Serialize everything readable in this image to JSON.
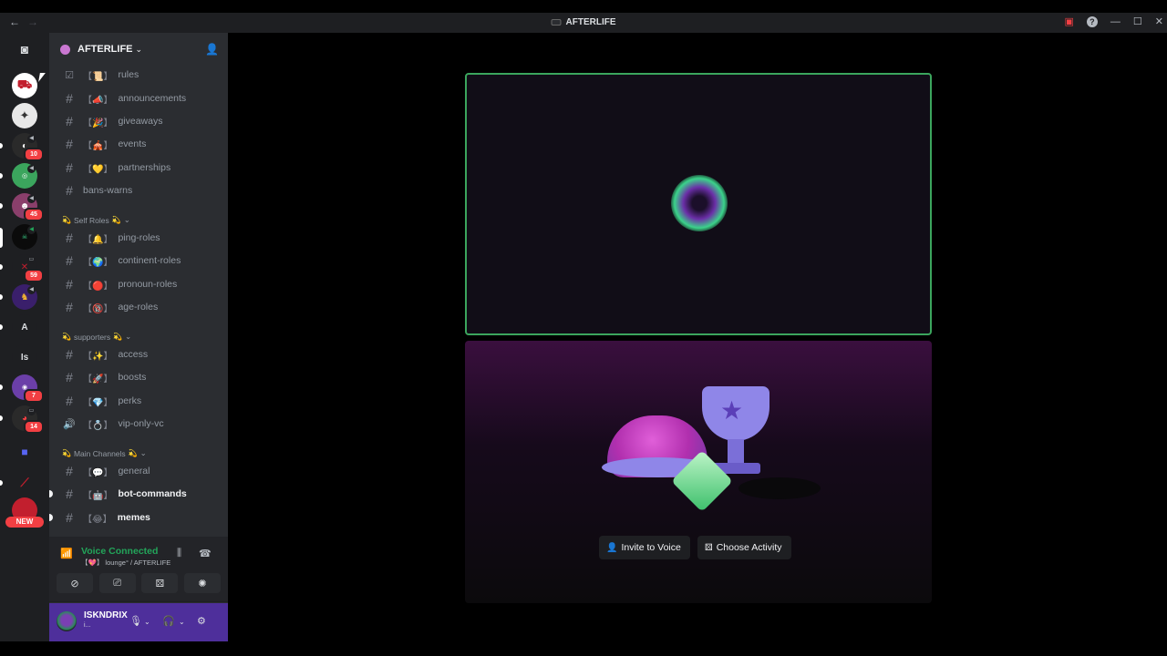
{
  "window": {
    "title": "AFTERLIFE",
    "back_icon": "←",
    "forward_icon": "→"
  },
  "server": {
    "name": "AFTERLIFE"
  },
  "rail": {
    "badges": [
      "10",
      "45",
      "59",
      "7",
      "14"
    ],
    "letter_servers": [
      "A",
      "Is"
    ],
    "new_label": "NEW"
  },
  "channels": {
    "info": [
      {
        "emoji": "【📜】",
        "name": "rules"
      },
      {
        "emoji": "【📣】",
        "name": "announcements"
      },
      {
        "emoji": "【🎉】",
        "name": "giveaways"
      },
      {
        "emoji": "【🎪】",
        "name": "events"
      },
      {
        "emoji": "【💛】",
        "name": "partnerships"
      },
      {
        "emoji": "",
        "name": "bans-warns"
      }
    ],
    "cat_self_roles": "Self Roles",
    "self_roles": [
      {
        "emoji": "【🔔】",
        "name": "ping-roles"
      },
      {
        "emoji": "【🌍】",
        "name": "continent-roles"
      },
      {
        "emoji": "【🔴】",
        "name": "pronoun-roles"
      },
      {
        "emoji": "【🔞】",
        "name": "age-roles"
      }
    ],
    "cat_supporters": "supporters",
    "supporters": [
      {
        "emoji": "【✨】",
        "name": "access"
      },
      {
        "emoji": "【🚀】",
        "name": "boosts"
      },
      {
        "emoji": "【💎】",
        "name": "perks"
      },
      {
        "emoji": "【💍】",
        "name": "vip-only-vc"
      }
    ],
    "cat_main": "Main Channels",
    "main": [
      {
        "emoji": "【💬】",
        "name": "general"
      },
      {
        "emoji": "【🤖】",
        "name": "bot-commands"
      },
      {
        "emoji": "【😂】",
        "name": "memes"
      }
    ]
  },
  "voice": {
    "status": "Voice Connected",
    "location": "【💖】 lounge° / AFTERLIFE"
  },
  "user": {
    "name": "ISKNDRIX",
    "status": "i..."
  },
  "stage": {
    "invite_label": "Invite to Voice",
    "activity_label": "Choose Activity"
  },
  "colors": {
    "voice_green": "#23a55a",
    "speaking_border": "#3ba55d",
    "badge_red": "#f23f43",
    "user_panel": "#4e2f9b"
  }
}
